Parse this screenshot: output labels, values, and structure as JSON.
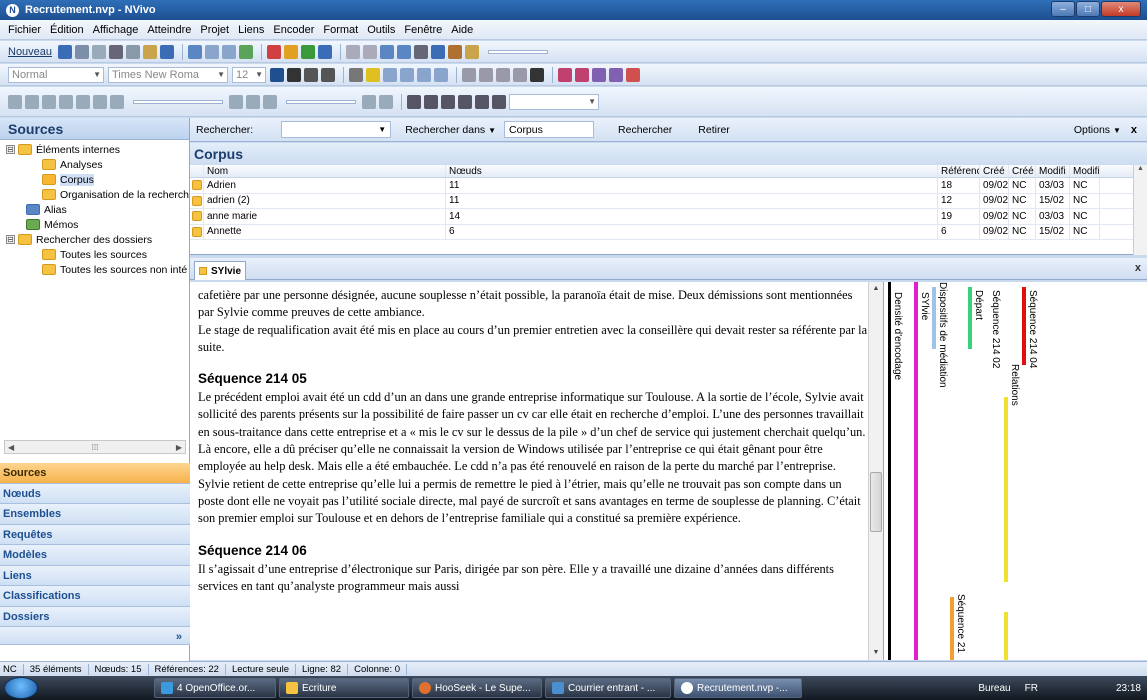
{
  "window": {
    "title": "Recrutement.nvp - NVivo",
    "app_icon": "nvivo-logo",
    "minimize": "–",
    "maximize": "□",
    "close": "x"
  },
  "menu": [
    "Fichier",
    "Édition",
    "Affichage",
    "Atteindre",
    "Projet",
    "Liens",
    "Encoder",
    "Format",
    "Outils",
    "Fenêtre",
    "Aide"
  ],
  "toolbar1": {
    "new_label": "Nouveau"
  },
  "toolbar2": {
    "style_value": "Normal",
    "font_value": "Times New Roma",
    "size_value": "12"
  },
  "sources_pane": {
    "title": "Sources",
    "tree": [
      {
        "label": "Éléments internes",
        "level": 0,
        "expander": "⊟"
      },
      {
        "label": "Analyses",
        "level": 1
      },
      {
        "label": "Corpus",
        "level": 1,
        "selected": true
      },
      {
        "label": "Organisation de la recherch",
        "level": 1
      },
      {
        "label": "Alias",
        "level": 0
      },
      {
        "label": "Mémos",
        "level": 0
      },
      {
        "label": "Rechercher des dossiers",
        "level": 0,
        "expander": "⊟"
      },
      {
        "label": "Toutes les sources",
        "level": 1
      },
      {
        "label": "Toutes les sources non inté",
        "level": 1
      }
    ],
    "nav": [
      "Sources",
      "Nœuds",
      "Ensembles",
      "Requêtes",
      "Modèles",
      "Liens",
      "Classifications",
      "Dossiers"
    ],
    "more": "»"
  },
  "search": {
    "label": "Rechercher:",
    "value": "",
    "in_label": "Rechercher dans",
    "in_value": "Corpus",
    "search_button": "Rechercher",
    "clear_button": "Retirer",
    "options": "Options",
    "close": "x"
  },
  "corpus": {
    "title": "Corpus",
    "columns": [
      "Nom",
      "Nœuds",
      "Référence",
      "Créé l",
      "Créé",
      "Modifi",
      "Modifi"
    ],
    "rows": [
      [
        "Adrien",
        "11",
        "18",
        "09/02",
        "NC",
        "03/03",
        "NC"
      ],
      [
        "adrien (2)",
        "11",
        "12",
        "09/02",
        "NC",
        "15/02",
        "NC"
      ],
      [
        "anne marie",
        "14",
        "19",
        "09/02",
        "NC",
        "03/03",
        "NC"
      ],
      [
        "Annette",
        "6",
        "6",
        "09/02",
        "NC",
        "15/02",
        "NC"
      ]
    ]
  },
  "doc_tab": {
    "label": "SYlvie",
    "close": "x"
  },
  "document": {
    "para0": "cafetière par une personne désignée, aucune souplesse n’était possible, la paranoïa était de mise. Deux démissions sont mentionnées par Sylvie comme preuves de cette ambiance.",
    "para1": "Le stage de requalification avait été mis en place au cours d’un premier entretien avec la conseillère qui devait rester sa référente par la suite.",
    "heading1": "Séquence 214 05",
    "para2": "Le précédent emploi avait été un cdd d’un an dans une grande entreprise informatique sur Toulouse. A la sortie de l’école, Sylvie avait sollicité des parents présents sur la possibilité de faire passer un cv car elle était en recherche d’emploi. L’une des personnes travaillait en sous-traitance dans cette entreprise et a « mis le cv sur le dessus de la pile » d’un chef de service qui justement cherchait quelqu’un. Là encore, elle a dû préciser qu’elle ne connaissait la version de Windows utilisée par l’entreprise ce qui était gênant pour être employée au help desk. Mais elle a été embauchée. Le cdd n’a pas été renouvelé en raison de la perte du marché par l’entreprise. Sylvie retient de cette entreprise qu’elle lui a permis de remettre le pied à l’étrier, mais qu’elle ne trouvait pas son compte dans un poste dont elle ne voyait pas l’utilité sociale directe, mal payé de surcroît et sans avantages en terme de souplesse de planning. C’était son premier emploi sur Toulouse et en dehors de l’entreprise familiale qui a constitué sa première expérience.",
    "heading2": "Séquence 214 06",
    "para3": "Il s’agissait d’une entreprise d’électronique sur Paris, dirigée par son père. Elle y a travaillé une dizaine d’années dans différents services en tant qu’analyste programmeur mais aussi"
  },
  "stripes": {
    "labels": {
      "density": "Densité d'encodage",
      "sylvie": "SYlvie",
      "dispositifs": "Dispositifs de médiation",
      "depart": "Départ",
      "seq02": "Séquence 214 02",
      "relations": "Relations",
      "seq04": "Séquence 214 04",
      "seq2x": "Séquence 21"
    },
    "colors": {
      "density": "#000000",
      "sylvie": "#e020d0",
      "dispositifs": "#9ec3e6",
      "depart": "#3bd07a",
      "seq02": "#f0a030",
      "relations": "#f0e030",
      "seq04": "#e01010",
      "seq2x": "#f0a030"
    }
  },
  "status": [
    "NC",
    "35 éléments",
    "Nœuds: 15",
    "Références: 22",
    "Lecture seule",
    "Ligne: 82",
    "Colonne: 0"
  ],
  "taskbar": {
    "tasks": [
      "4 OpenOffice.or...",
      "Ecriture",
      "HooSeek - Le Supe...",
      "Courrier entrant - ...",
      "Recrutement.nvp -..."
    ],
    "bureau": "Bureau",
    "lang": "FR",
    "time": "23:18"
  }
}
